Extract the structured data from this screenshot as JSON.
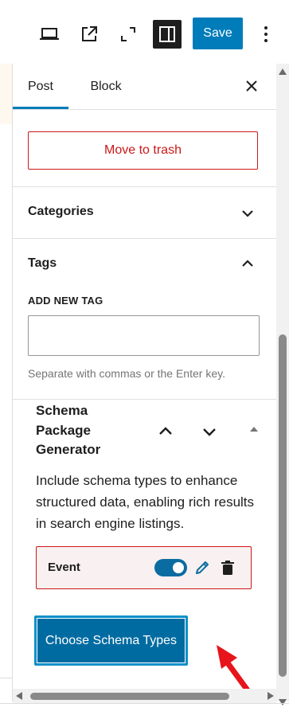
{
  "toolbar": {
    "view_icon": "laptop-icon",
    "preview_icon": "external-link-icon",
    "fullscreen_icon": "fullscreen-icon",
    "settings_icon": "sidebar-toggle-icon",
    "save_label": "Save",
    "options_icon": "vertical-ellipsis-icon"
  },
  "tabs": {
    "post": "Post",
    "block": "Block",
    "close_icon": "close-icon"
  },
  "post": {
    "trash_label": "Move to trash",
    "categories_title": "Categories",
    "tags_title": "Tags",
    "tags_field_label": "ADD NEW TAG",
    "tags_input_value": "",
    "tags_help": "Separate with commas or the Enter key."
  },
  "schema": {
    "title": "Schema Package Generator",
    "description": "Include schema types to enhance structured data, enabling rich results in search engine listings.",
    "items": [
      {
        "label": "Event",
        "enabled": true
      }
    ],
    "choose_label": "Choose Schema Types"
  },
  "colors": {
    "accent": "#007cba",
    "danger": "#cc1818",
    "toggle_on": "#0a6ca0",
    "annotation": "#e8141b"
  }
}
